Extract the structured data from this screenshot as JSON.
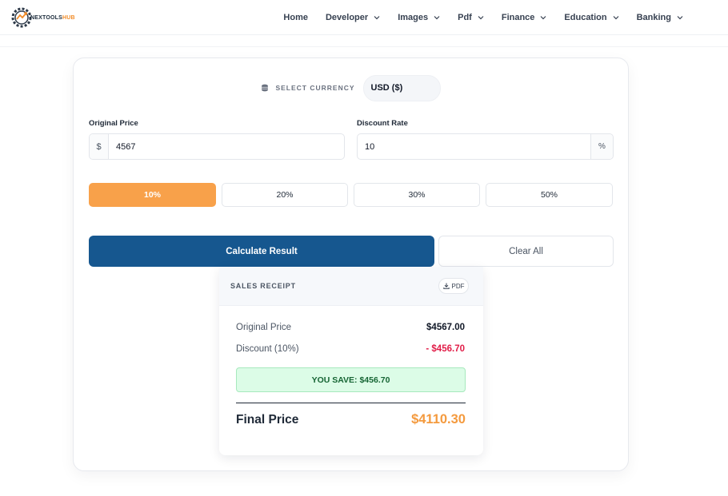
{
  "brand": {
    "name_prefix": "NEXTOOLS",
    "name_suffix": "HUB",
    "accent": "#f28c28"
  },
  "nav": [
    {
      "label": "Home",
      "has_dropdown": false
    },
    {
      "label": "Developer",
      "has_dropdown": true
    },
    {
      "label": "Images",
      "has_dropdown": true
    },
    {
      "label": "Pdf",
      "has_dropdown": true
    },
    {
      "label": "Finance",
      "has_dropdown": true
    },
    {
      "label": "Education",
      "has_dropdown": true
    },
    {
      "label": "Banking",
      "has_dropdown": true
    }
  ],
  "currency": {
    "label": "SELECT CURRENCY",
    "icon": "coins-icon",
    "selected": "USD ($)"
  },
  "original_price": {
    "label": "Original Price",
    "prefix": "$",
    "value": "4567"
  },
  "discount_rate": {
    "label": "Discount Rate",
    "value": "10",
    "suffix": "%"
  },
  "presets": [
    {
      "label": "10%",
      "active": true
    },
    {
      "label": "20%",
      "active": false
    },
    {
      "label": "30%",
      "active": false
    },
    {
      "label": "50%",
      "active": false
    }
  ],
  "actions": {
    "calculate": "Calculate Result",
    "clear": "Clear All"
  },
  "receipt": {
    "title": "SALES RECEIPT",
    "pdf_label": "PDF",
    "original_label": "Original Price",
    "original_value": "$4567.00",
    "discount_label": "Discount (10%)",
    "discount_value": "- $456.70",
    "save_text": "YOU SAVE: $456.70",
    "final_label": "Final Price",
    "final_value": "$4110.30"
  },
  "colors": {
    "primary": "#16578f",
    "preset_active": "#f8a14a",
    "final_price": "#f49a3e",
    "discount": "#e11d48",
    "save_bg": "#dcfce7",
    "save_text": "#166534"
  }
}
